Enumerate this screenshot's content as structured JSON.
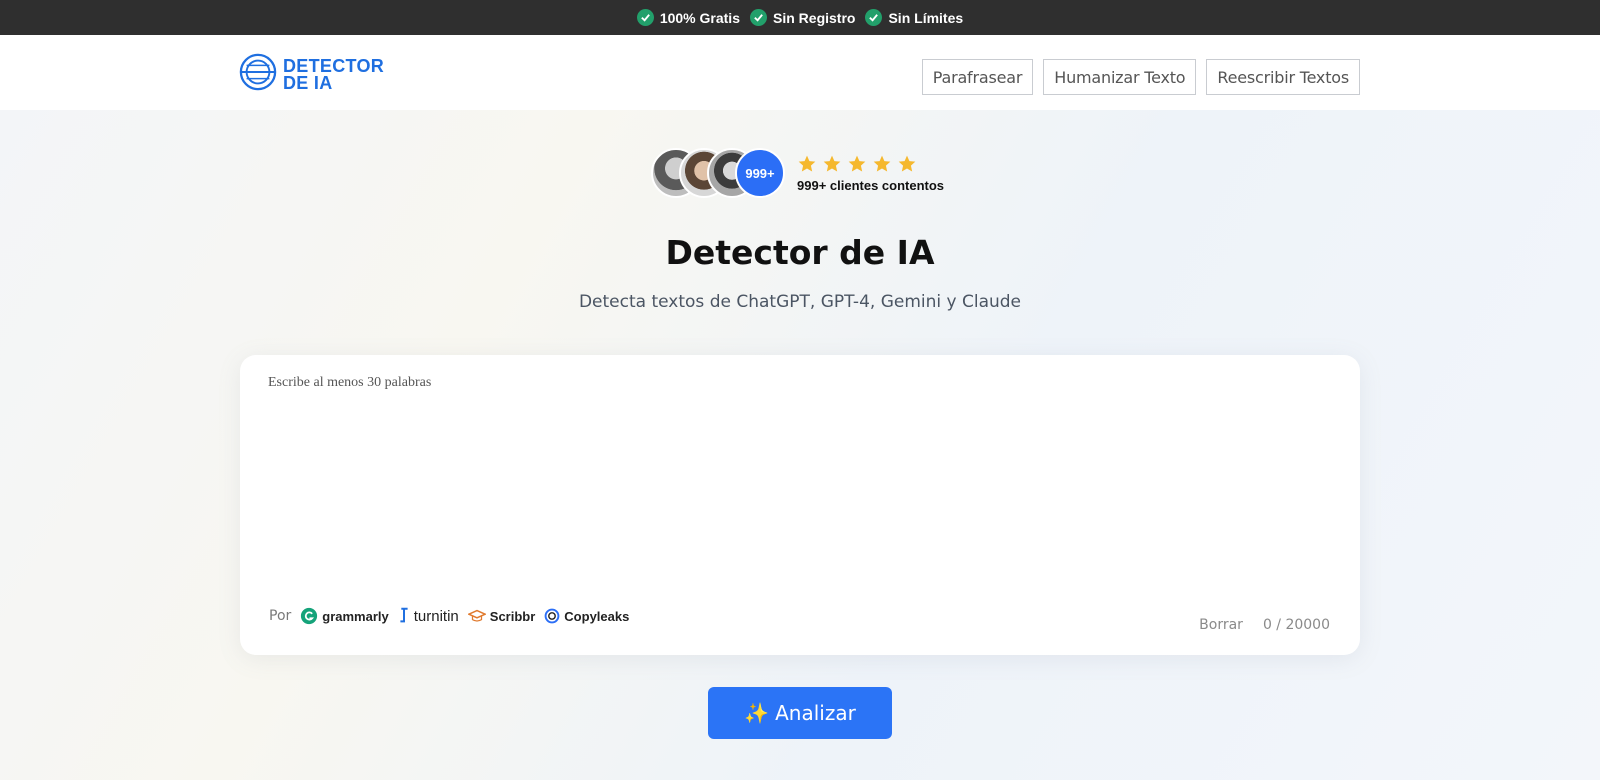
{
  "topbar": {
    "features": [
      "100% Gratis",
      "Sin Registro",
      "Sin Límites"
    ],
    "check_color": "#22a06b"
  },
  "header": {
    "logo_line1": "DETECTOR",
    "logo_line2": "DE IA",
    "nav": [
      "Parafrasear",
      "Humanizar Texto",
      "Reescribir Textos"
    ]
  },
  "social_proof": {
    "count_badge": "999+",
    "stars": 5,
    "text": "999+ clientes contentos",
    "star_color": "#f5b82e"
  },
  "hero": {
    "title": "Detector de IA",
    "subtitle": "Detecta textos de ChatGPT, GPT-4, Gemini y Claude"
  },
  "editor": {
    "placeholder": "Escribe al menos 30 palabras",
    "value": "",
    "powered_by_label": "Por",
    "brands": [
      "grammarly",
      "turnitin",
      "Scribbr",
      "Copyleaks"
    ],
    "clear_label": "Borrar",
    "counter": "0 / 20000"
  },
  "analyze_button": {
    "icon": "✨",
    "label": "Analizar",
    "color": "#2b74f6"
  }
}
